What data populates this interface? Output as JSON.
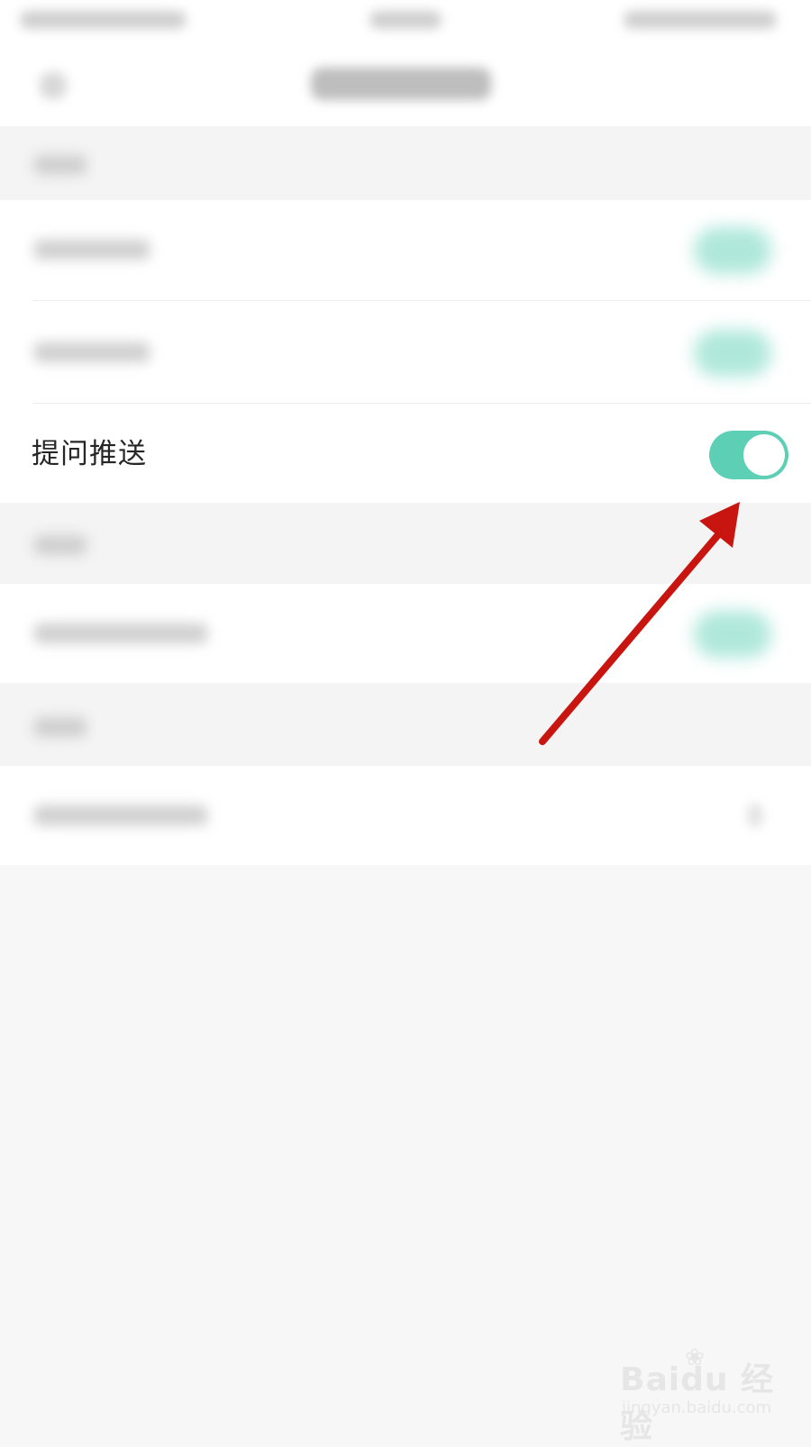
{
  "settings": {
    "highlighted_row": {
      "label": "提问推送",
      "toggle_on": true
    }
  },
  "colors": {
    "toggle_on": "#5ccfb5",
    "arrow": "#c8150f",
    "background": "#f7f7f7"
  },
  "watermark": {
    "logo": "Bai",
    "logo_suffix": "du 经验",
    "url": "jingyan.baidu.com"
  }
}
